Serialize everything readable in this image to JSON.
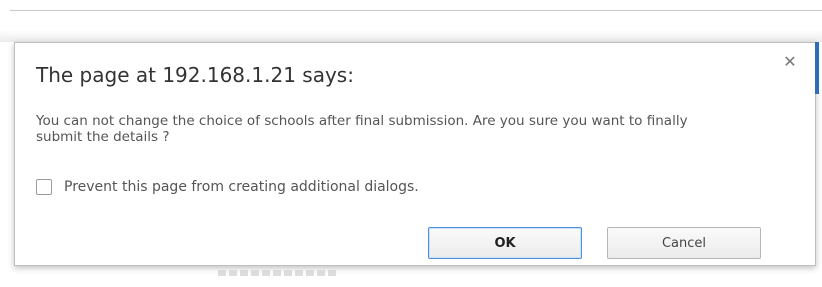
{
  "dialog": {
    "title": "The page at 192.168.1.21 says:",
    "message": "You can not change the choice of schools after final submission. Are you sure you want to finally submit the details ?",
    "prevent_checkbox_label": "Prevent this page from creating additional dialogs.",
    "prevent_checkbox_checked": false,
    "ok_label": "OK",
    "cancel_label": "Cancel",
    "close_icon": "close-icon"
  },
  "colors": {
    "ok_border": "#4a8fe0",
    "accent": "#2d6fb6"
  }
}
